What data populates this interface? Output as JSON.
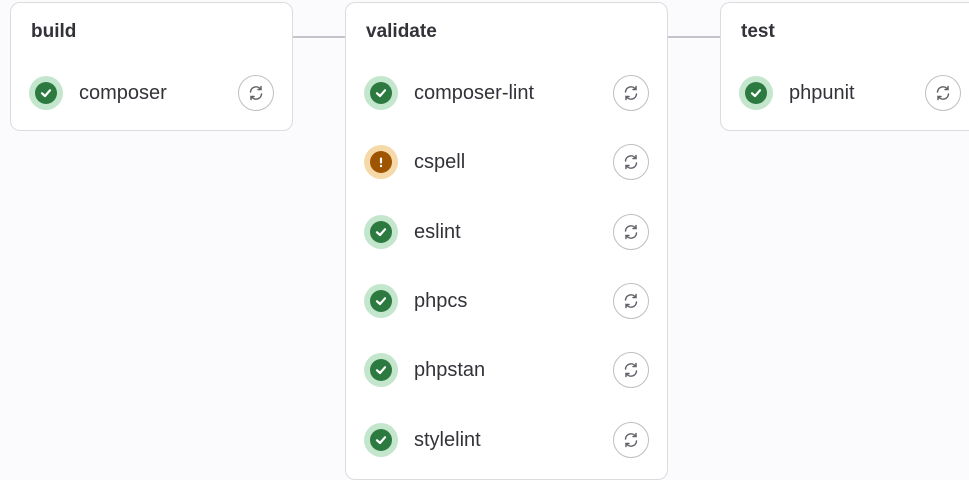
{
  "stages": [
    {
      "title": "build",
      "jobs": [
        {
          "name": "composer",
          "status": "success",
          "icon": "check-circle-icon"
        }
      ]
    },
    {
      "title": "validate",
      "jobs": [
        {
          "name": "composer-lint",
          "status": "success",
          "icon": "check-circle-icon"
        },
        {
          "name": "cspell",
          "status": "warning",
          "icon": "exclamation-circle-icon"
        },
        {
          "name": "eslint",
          "status": "success",
          "icon": "check-circle-icon"
        },
        {
          "name": "phpcs",
          "status": "success",
          "icon": "check-circle-icon"
        },
        {
          "name": "phpstan",
          "status": "success",
          "icon": "check-circle-icon"
        },
        {
          "name": "stylelint",
          "status": "success",
          "icon": "check-circle-icon"
        }
      ]
    },
    {
      "title": "test",
      "jobs": [
        {
          "name": "phpunit",
          "status": "success",
          "icon": "check-circle-icon"
        }
      ]
    }
  ],
  "actions": {
    "retry_icon": "retry-icon"
  },
  "colors": {
    "success": "#2d7a41",
    "success_ring": "#c3e6cd",
    "warning": "#9e5400",
    "warning_ring": "#f5d9a8",
    "border": "#dcdcde",
    "background": "#fbfafd"
  }
}
